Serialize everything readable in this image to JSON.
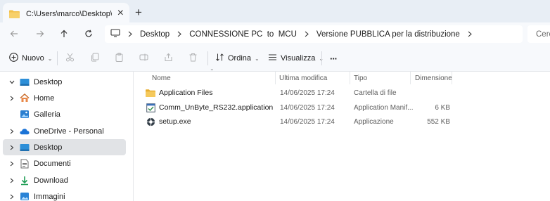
{
  "window": {
    "tab_title": "C:\\Users\\marco\\Desktop\\CON",
    "close_glyph": "×",
    "new_tab_glyph": "+"
  },
  "address": {
    "breadcrumbs": [
      "Desktop",
      "CONNESSIONE PC  to  MCU",
      "Versione PUBBLICA per la distribuzione"
    ],
    "search_placeholder": "Cerca"
  },
  "commands": {
    "new_label": "Nuovo",
    "sort_label": "Ordina",
    "view_label": "Visualizza",
    "more_glyph": "···"
  },
  "navigation": {
    "items": [
      {
        "label": "Desktop",
        "icon": "desktop-icon"
      },
      {
        "label": "Home",
        "icon": "home-icon"
      },
      {
        "label": "Galleria",
        "icon": "gallery-icon"
      },
      {
        "label": "OneDrive - Personal",
        "icon": "onedrive-icon"
      },
      {
        "label": "Desktop",
        "icon": "desktop-icon"
      },
      {
        "label": "Documenti",
        "icon": "documents-icon"
      },
      {
        "label": "Download",
        "icon": "download-icon"
      },
      {
        "label": "Immagini",
        "icon": "pictures-icon"
      }
    ]
  },
  "files": {
    "columns": [
      "Nome",
      "Ultima modifica",
      "Tipo",
      "Dimensione"
    ],
    "rows": [
      {
        "name": "Application Files",
        "modified": "14/06/2025 17:24",
        "type": "Cartella di file",
        "size": "",
        "icon": "folder-icon"
      },
      {
        "name": "Comm_UnByte_RS232.application",
        "modified": "14/06/2025 17:24",
        "type": "Application Manif...",
        "size": "6 KB",
        "icon": "application-manifest-icon"
      },
      {
        "name": "setup.exe",
        "modified": "14/06/2025 17:24",
        "type": "Applicazione",
        "size": "552 KB",
        "icon": "setup-exe-icon"
      }
    ]
  },
  "colors": {
    "folder": "#f2c04b",
    "accent": "#0067c0",
    "selected_bg": "#e1e3e6"
  }
}
